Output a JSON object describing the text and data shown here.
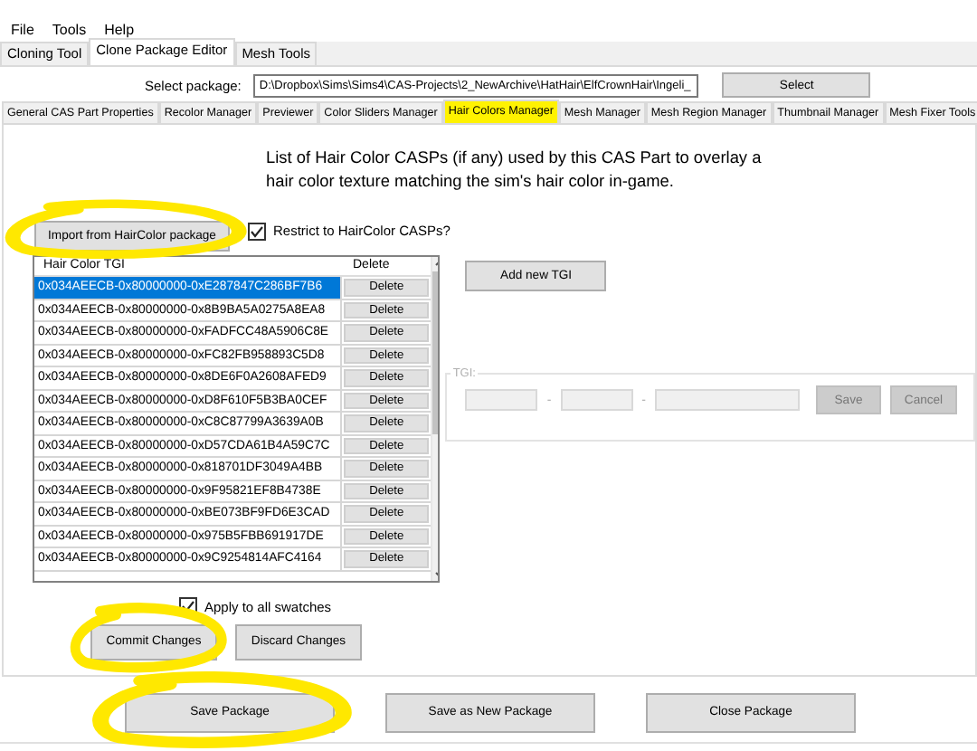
{
  "menu": [
    "File",
    "Tools",
    "Help"
  ],
  "top_tabs": [
    {
      "label": "Cloning Tool",
      "selected": false
    },
    {
      "label": "Clone Package Editor",
      "selected": true
    },
    {
      "label": "Mesh Tools",
      "selected": false
    }
  ],
  "package": {
    "label": "Select package:",
    "value": "D:\\Dropbox\\Sims\\Sims4\\CAS-Projects\\2_NewArchive\\HatHair\\ElfCrownHair\\Ingeli_",
    "button": "Select"
  },
  "sub_tabs": [
    {
      "label": "General CAS Part Properties",
      "selected": false,
      "highlighted": false
    },
    {
      "label": "Recolor Manager",
      "selected": false,
      "highlighted": false
    },
    {
      "label": "Previewer",
      "selected": false,
      "highlighted": false
    },
    {
      "label": "Color Sliders Manager",
      "selected": false,
      "highlighted": false
    },
    {
      "label": "Hair Colors Manager",
      "selected": true,
      "highlighted": true
    },
    {
      "label": "Mesh Manager",
      "selected": false,
      "highlighted": false
    },
    {
      "label": "Mesh Region Manager",
      "selected": false,
      "highlighted": false
    },
    {
      "label": "Thumbnail Manager",
      "selected": false,
      "highlighted": false
    },
    {
      "label": "Mesh Fixer Tools",
      "selected": false,
      "highlighted": false
    }
  ],
  "description": "List of Hair Color CASPs (if any) used by this CAS Part to overlay a hair color texture matching the sim's hair color in-game.",
  "import_button": {
    "label": "Import from HairColor package",
    "circled": true
  },
  "restrict_checkbox": {
    "label": "Restrict to HairColor CASPs?",
    "checked": true
  },
  "table": {
    "columns": [
      "Hair Color TGI",
      "Delete"
    ],
    "rows": [
      {
        "tgi": "0x034AEECB-0x80000000-0xE287847C286BF7B6",
        "action": "Delete",
        "selected": true
      },
      {
        "tgi": "0x034AEECB-0x80000000-0x8B9BA5A0275A8EA8",
        "action": "Delete",
        "selected": false
      },
      {
        "tgi": "0x034AEECB-0x80000000-0xFADFCC48A5906C8E",
        "action": "Delete",
        "selected": false
      },
      {
        "tgi": "0x034AEECB-0x80000000-0xFC82FB958893C5D8",
        "action": "Delete",
        "selected": false
      },
      {
        "tgi": "0x034AEECB-0x80000000-0x8DE6F0A2608AFED9",
        "action": "Delete",
        "selected": false
      },
      {
        "tgi": "0x034AEECB-0x80000000-0xD8F610F5B3BA0CEF",
        "action": "Delete",
        "selected": false
      },
      {
        "tgi": "0x034AEECB-0x80000000-0xC8C87799A3639A0B",
        "action": "Delete",
        "selected": false
      },
      {
        "tgi": "0x034AEECB-0x80000000-0xD57CDA61B4A59C7C",
        "action": "Delete",
        "selected": false
      },
      {
        "tgi": "0x034AEECB-0x80000000-0x818701DF3049A4BB",
        "action": "Delete",
        "selected": false
      },
      {
        "tgi": "0x034AEECB-0x80000000-0x9F95821EF8B4738E",
        "action": "Delete",
        "selected": false
      },
      {
        "tgi": "0x034AEECB-0x80000000-0xBE073BF9FD6E3CAD",
        "action": "Delete",
        "selected": false
      },
      {
        "tgi": "0x034AEECB-0x80000000-0x975B5FBB691917DE",
        "action": "Delete",
        "selected": false
      },
      {
        "tgi": "0x034AEECB-0x80000000-0x9C9254814AFC4164",
        "action": "Delete",
        "selected": false
      }
    ]
  },
  "apply_checkbox": {
    "label": "Apply to all swatches",
    "checked": true
  },
  "add_button": "Add new TGI",
  "tgi_group": {
    "label": "TGI:",
    "separators": [
      "-",
      "-"
    ],
    "save": "Save",
    "cancel": "Cancel"
  },
  "change_buttons": [
    {
      "label": "Commit Changes",
      "circled": true
    },
    {
      "label": "Discard Changes",
      "circled": false
    }
  ],
  "package_buttons": [
    {
      "label": "Save Package",
      "circled": true
    },
    {
      "label": "Save as New Package",
      "circled": false
    },
    {
      "label": "Close Package",
      "circled": false
    }
  ]
}
